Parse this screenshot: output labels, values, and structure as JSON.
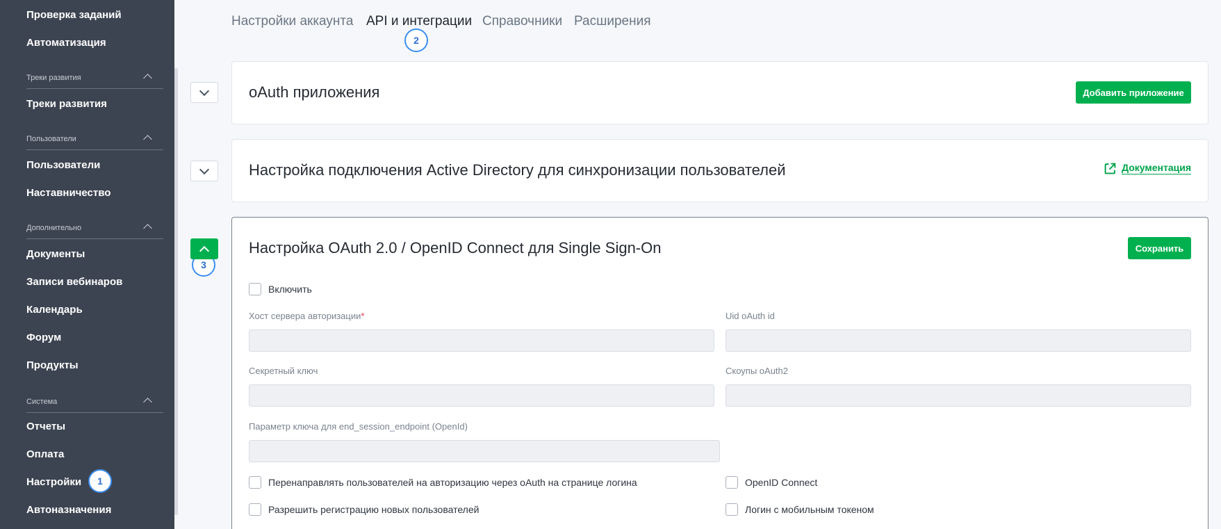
{
  "sidebar": {
    "items_top": [
      {
        "label": "Проверка заданий"
      },
      {
        "label": "Автоматизация"
      }
    ],
    "sections": [
      {
        "title": "Треки развития",
        "items": [
          {
            "label": "Треки развития"
          }
        ]
      },
      {
        "title": "Пользователи",
        "items": [
          {
            "label": "Пользователи"
          },
          {
            "label": "Наставничество"
          }
        ]
      },
      {
        "title": "Дополнительно",
        "items": [
          {
            "label": "Документы"
          },
          {
            "label": "Записи вебинаров"
          },
          {
            "label": "Календарь"
          },
          {
            "label": "Форум"
          },
          {
            "label": "Продукты"
          }
        ]
      },
      {
        "title": "Система",
        "items": [
          {
            "label": "Отчеты"
          },
          {
            "label": "Оплата"
          },
          {
            "label": "Настройки"
          },
          {
            "label": "Автоназначения"
          }
        ]
      }
    ]
  },
  "steps": [
    "1",
    "2",
    "3"
  ],
  "tabs": [
    {
      "label": "Настройки аккаунта"
    },
    {
      "label": "API и интеграции",
      "active": true
    },
    {
      "label": "Справочники"
    },
    {
      "label": "Расширения"
    }
  ],
  "cards": {
    "oauth_apps": {
      "title": "oAuth приложения",
      "button": "Добавить приложение"
    },
    "active_directory": {
      "title": "Настройка подключения Active Directory для синхронизации пользователей",
      "link": "Документация"
    },
    "sso": {
      "title": "Настройка OAuth 2.0 / OpenID Connect для Single Sign-On",
      "button": "Сохранить",
      "enable_label": "Включить",
      "fields": {
        "host": {
          "label": "Хост сервера авторизации",
          "required": "*",
          "value": ""
        },
        "uid": {
          "label": "Uid oAuth id",
          "value": ""
        },
        "secret": {
          "label": "Секретный ключ",
          "value": ""
        },
        "scopes": {
          "label": "Скоупы oAuth2",
          "value": ""
        },
        "end_session": {
          "label": "Параметр ключа для end_session_endpoint (OpenId)",
          "value": ""
        }
      },
      "options": {
        "redirect": "Перенаправлять пользователей на авторизацию через oAuth на странице логина",
        "openid": "OpenID Connect",
        "allow_register": "Разрешить регистрацию новых пользователей",
        "mobile_token": "Логин с мобильным токеном"
      }
    }
  },
  "colors": {
    "sidebar_bg": "#3d4451",
    "accent_green": "#00b04f",
    "step_blue": "#3b8ef0"
  }
}
